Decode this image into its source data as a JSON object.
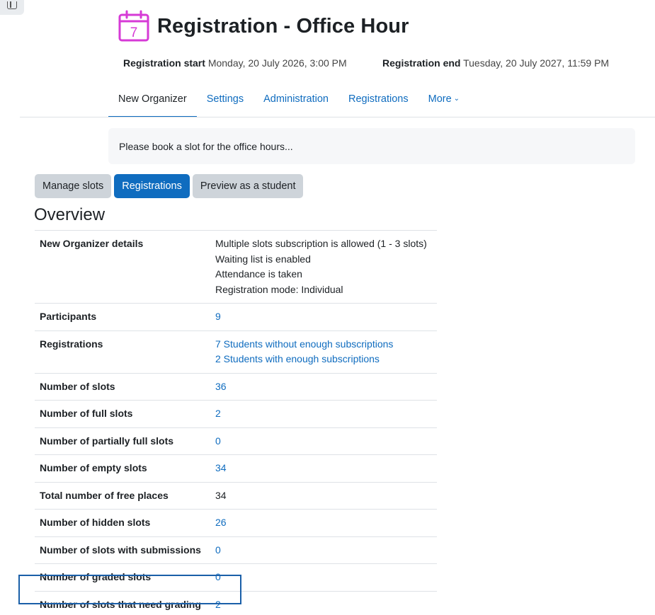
{
  "header": {
    "title": "Registration - Office Hour",
    "icon_day": "7",
    "icon_color": "#d63ad6"
  },
  "dates": {
    "start_label": "Registration start",
    "start_value": "Monday, 20 July 2026, 3:00 PM",
    "end_label": "Registration end",
    "end_value": "Tuesday, 20 July 2027, 11:59 PM"
  },
  "secondary_nav": {
    "items": [
      {
        "label": "New Organizer",
        "active": true
      },
      {
        "label": "Settings"
      },
      {
        "label": "Administration"
      },
      {
        "label": "Registrations"
      },
      {
        "label": "More"
      }
    ]
  },
  "intro": {
    "text": "Please book a slot for the office hours..."
  },
  "actions": {
    "manage_slots": "Manage slots",
    "registrations": "Registrations",
    "preview": "Preview as a student"
  },
  "overview": {
    "title": "Overview",
    "rows": [
      {
        "label": "New Organizer details",
        "values": [
          "Multiple slots subscription is allowed (1 - 3 slots)",
          "Waiting list is enabled",
          "Attendance is taken",
          "Registration mode: Individual"
        ]
      },
      {
        "label": "Participants",
        "values": [
          "9"
        ]
      },
      {
        "label": "Registrations",
        "values": [
          "7 Students without enough subscriptions",
          "2 Students with enough subscriptions"
        ]
      },
      {
        "label": "Number of slots",
        "values": [
          "36"
        ]
      },
      {
        "label": "Number of full slots",
        "values": [
          "2"
        ]
      },
      {
        "label": "Number of partially full slots",
        "values": [
          "0"
        ]
      },
      {
        "label": "Number of empty slots",
        "values": [
          "34"
        ]
      },
      {
        "label": "Total number of free places",
        "values": [
          "34"
        ]
      },
      {
        "label": "Number of hidden slots",
        "values": [
          "26"
        ]
      },
      {
        "label": "Number of slots with submissions",
        "values": [
          "0"
        ]
      },
      {
        "label": "Number of graded slots",
        "values": [
          "0"
        ]
      },
      {
        "label": "Number of slots that need grading",
        "values": [
          "2"
        ]
      }
    ]
  },
  "colors": {
    "primary": "#0f6cbf",
    "highlight_box": "#1a5fa8"
  }
}
